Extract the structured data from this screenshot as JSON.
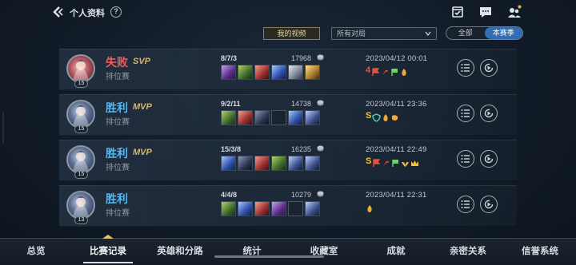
{
  "header": {
    "title": "个人资料",
    "help_label": "?",
    "icons": [
      "back-arrow-icon",
      "help-icon",
      "calendar-check-icon",
      "chat-icon",
      "friends-icon"
    ],
    "notification_dot_color": "#e9b649"
  },
  "filters": {
    "my_videos_label": "我的视频",
    "match_filter_value": "所有对局",
    "season_toggle": {
      "all_label": "全部",
      "current_label": "本赛季",
      "selected": "本赛季"
    }
  },
  "matches": [
    {
      "result": "失败",
      "result_type": "lose",
      "tag": "SVP",
      "mode": "排位赛",
      "level": "15",
      "kda": "8/7/3",
      "gold": "17968",
      "datetime": "2023/04/12 00:01",
      "items": [
        "item-purple",
        "item-green",
        "item-red",
        "item-blue",
        "item-silver",
        "item-gold"
      ],
      "badges": [
        "4",
        "red-flag",
        "red-scythe",
        "green-flag",
        "orange-flame"
      ]
    },
    {
      "result": "胜利",
      "result_type": "win",
      "tag": "MVP",
      "mode": "排位赛",
      "level": "15",
      "kda": "9/2/11",
      "gold": "14738",
      "datetime": "2023/04/11 23:36",
      "items": [
        "item-green",
        "item-red",
        "item-dark",
        "empty",
        "item-blue",
        "item-teal"
      ],
      "badges": [
        "S",
        "teal-shield",
        "orange-flame",
        "orange-boot"
      ]
    },
    {
      "result": "胜利",
      "result_type": "win",
      "tag": "MVP",
      "mode": "排位赛",
      "level": "15",
      "kda": "15/3/8",
      "gold": "16235",
      "datetime": "2023/04/11 22:49",
      "items": [
        "item-blue",
        "item-dark",
        "item-red",
        "item-green",
        "item-teal",
        "item-teal"
      ],
      "badges": [
        "S",
        "red-flag",
        "red-scythe",
        "green-flag",
        "gold-wings",
        "gold-crown"
      ]
    },
    {
      "result": "胜利",
      "result_type": "win",
      "tag": "",
      "mode": "排位赛",
      "level": "13",
      "kda": "4/4/8",
      "gold": "10279",
      "datetime": "2023/04/11 22:31",
      "items": [
        "item-green",
        "item-blue",
        "item-red",
        "item-purple",
        "empty",
        "item-teal"
      ],
      "badges": [
        "orange-flame"
      ]
    }
  ],
  "nav": {
    "tabs": [
      "总览",
      "比赛记录",
      "英雄和分路",
      "统计",
      "收藏室",
      "成就",
      "亲密关系",
      "信誉系统"
    ],
    "active": "比赛记录"
  },
  "colors": {
    "lose": "#f05a5a",
    "win": "#57b6f0",
    "accent": "#2f6fb8",
    "mvp": "#d8b868"
  }
}
